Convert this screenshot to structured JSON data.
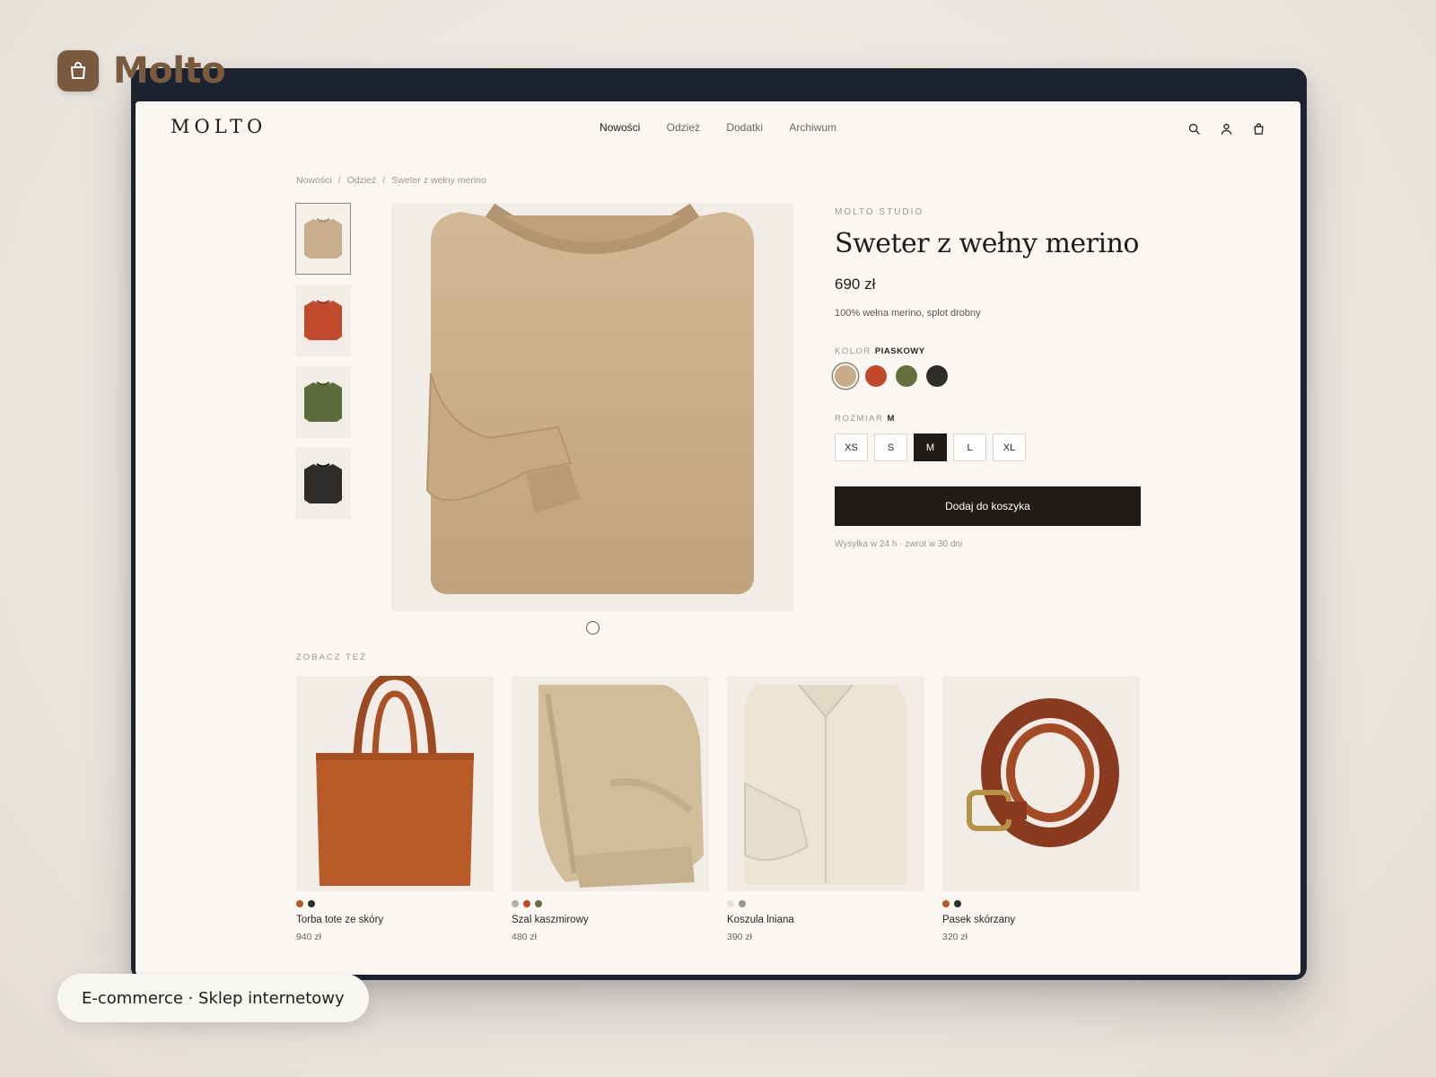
{
  "app": {
    "name": "Molto",
    "icon": "shopping-bag-icon",
    "accent": "#7a5a3e"
  },
  "site": {
    "logo": "MOLTO",
    "nav": [
      {
        "label": "Nowości",
        "active": true
      },
      {
        "label": "Odzież",
        "active": false
      },
      {
        "label": "Dodatki",
        "active": false
      },
      {
        "label": "Archiwum",
        "active": false
      }
    ],
    "header_icons": [
      "search-icon",
      "user-icon",
      "bag-icon"
    ]
  },
  "breadcrumb": [
    "Nowości",
    "Odzież",
    "Sweter z wełny merino"
  ],
  "breadcrumb_sep": "/",
  "product": {
    "brand": "MOLTO STUDIO",
    "title": "Sweter z wełny merino",
    "price": "690 zł",
    "description": "100% wełna merino, splot drobny",
    "color_label": "KOLOR",
    "color_selected": "PIASKOWY",
    "colors": [
      "#c8ab88",
      "#c3472d",
      "#66703f",
      "#302e2c"
    ],
    "size_label": "ROZMIAR",
    "size_selected": "M",
    "sizes": [
      "XS",
      "S",
      "M",
      "L",
      "XL"
    ],
    "add_to_cart": "Dodaj do koszyka",
    "shipping": "Wysyłka w 24 h · zwrot w 30 dni",
    "thumb_colors": [
      "#c9ad8a",
      "#c14a2e",
      "#5e6b3a",
      "#2e2c2a"
    ]
  },
  "related": {
    "label": "ZOBACZ TEŻ",
    "items": [
      {
        "name": "Torba tote ze skóry",
        "price": "940 zł",
        "dots": [
          "#b55a2a",
          "#2e2c2a"
        ]
      },
      {
        "name": "Szal kaszmirowy",
        "price": "480 zł",
        "dots": [
          "#b5aca2",
          "#c3472d",
          "#66703f"
        ]
      },
      {
        "name": "Koszula lniana",
        "price": "390 zł",
        "dots": [
          "#e6e0d6",
          "#9b958f"
        ]
      },
      {
        "name": "Pasek skórzany",
        "price": "320 zł",
        "dots": [
          "#b55a2a",
          "#2e2c2a"
        ]
      }
    ]
  },
  "footer_pill": "E-commerce · Sklep internetowy"
}
